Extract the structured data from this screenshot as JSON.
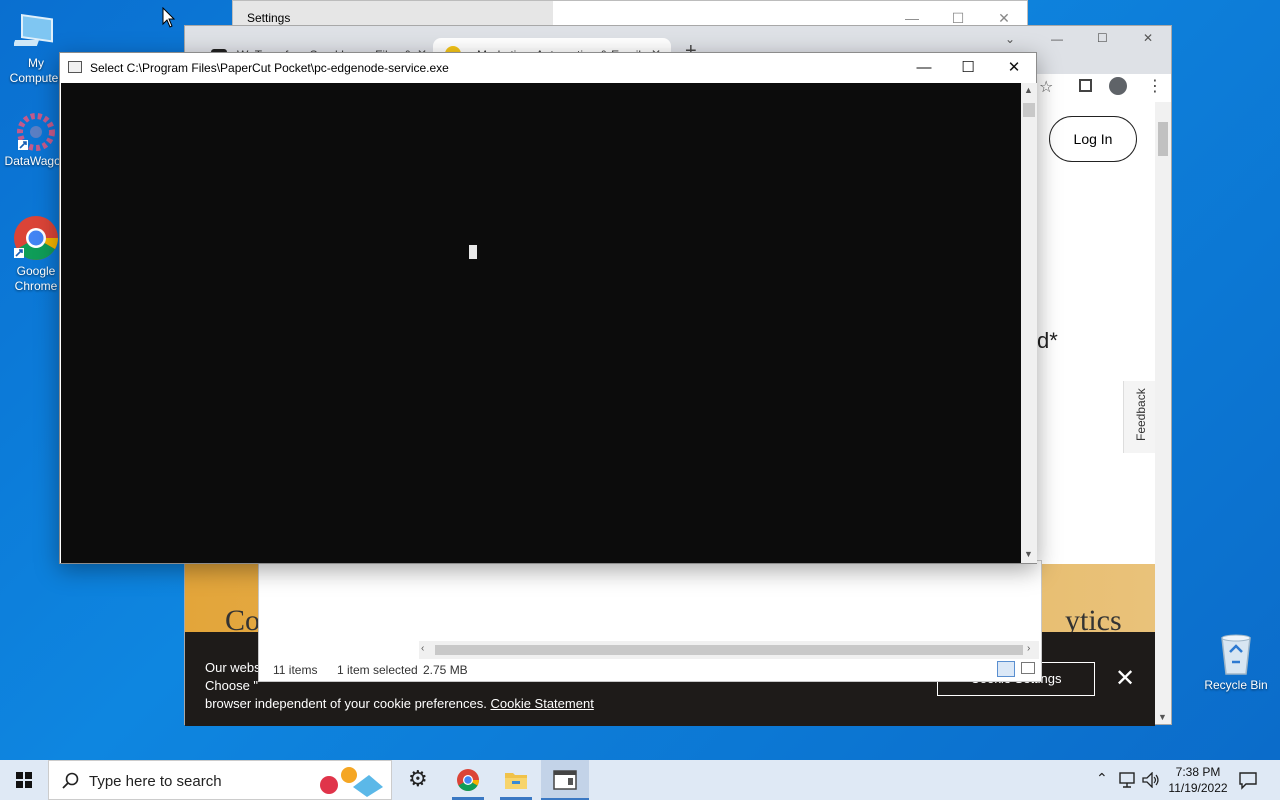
{
  "desktop": {
    "icons": [
      {
        "label": "My\nComputer",
        "icon": "computer-icon"
      },
      {
        "label": "DataWagon",
        "icon": "datawagon-icon"
      },
      {
        "label": "Google\nChrome",
        "icon": "chrome-icon"
      },
      {
        "label": "Recycle Bin",
        "icon": "recycle-bin-icon"
      }
    ]
  },
  "settings_window": {
    "title": "Settings",
    "controls": {
      "minimize": "—",
      "maximize": "☐",
      "close": "✕"
    }
  },
  "chrome_window": {
    "tabs": [
      {
        "label": "WeTransfer - Send Large Files &",
        "icon": "wetransfer-icon"
      },
      {
        "label": "Marketing, Automation & Email",
        "icon": "mailchimp-icon"
      }
    ],
    "new_tab": "+",
    "login_label": "Log In",
    "partial_heading": "d*",
    "feedback_label": "Feedback",
    "banner_left": "Co",
    "banner_right": "ytics",
    "cookie": {
      "line1": "Our webs",
      "line2": "Choose \"",
      "line3": "browser independent of your cookie preferences.",
      "link": "Cookie Statement",
      "settings_button": "Cookie Settings",
      "close": "✕"
    }
  },
  "explorer_window": {
    "item_count": "11 items",
    "selected": "1 item selected",
    "size": "2.75 MB"
  },
  "console_window": {
    "title": "Select C:\\Program Files\\PaperCut Pocket\\pc-edgenode-service.exe",
    "controls": {
      "minimize": "—",
      "maximize": "☐",
      "close": "✕"
    }
  },
  "taskbar": {
    "search_placeholder": "Type here to search",
    "time": "7:38 PM",
    "date": "11/19/2022",
    "pinned": [
      "settings-icon",
      "chrome-icon",
      "file-explorer-icon",
      "console-icon"
    ]
  },
  "colors": {
    "desktop_bg": "#0e86e0",
    "console_bg": "#0c0c0c",
    "cookie_bar_bg": "#1e1b19",
    "banner_gold": "#e3a53a"
  }
}
